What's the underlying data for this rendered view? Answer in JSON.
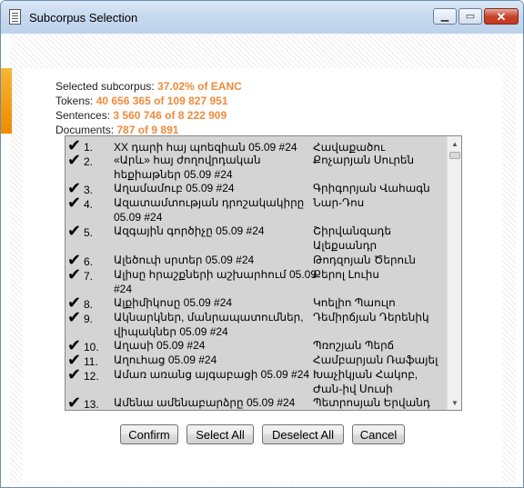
{
  "window": {
    "title": "Subcorpus Selection",
    "minimize": "▁",
    "maximize": "▭",
    "close": "✕"
  },
  "stats": {
    "selected_label": "Selected subcorpus:",
    "selected_value": "37.02% of EANC",
    "tokens_label": "Tokens:",
    "tokens_value": "40 656 365 of 109 827 951",
    "sentences_label": "Sentences:",
    "sentences_value": "3 560 746 of 8 222 909",
    "documents_label": "Documents:",
    "documents_value": "787 of 9 891"
  },
  "list": {
    "check_glyph": "✔",
    "items": [
      {
        "num": "1.",
        "title": "XX դարի հայ պոեզիան 05.09 #24",
        "author": "Հավաքածու",
        "checked": true
      },
      {
        "num": "2.",
        "title": "«Արև» հայ ժողովրդական հեքիաթներ 05.09 #24",
        "author": "Քոչարյան Սուրեն",
        "checked": true
      },
      {
        "num": "3.",
        "title": "Աղամամուբ 05.09 #24",
        "author": "Գրիգորյան Վահագն",
        "checked": true
      },
      {
        "num": "4.",
        "title": "Ազատամտության դրոշակակիրը 05.09 #24",
        "author": "Նար-Դոս",
        "checked": true
      },
      {
        "num": "5.",
        "title": "Ազգային գործիչը 05.09 #24",
        "author": "Շիրվանզադե Ալեքսանդր",
        "checked": true
      },
      {
        "num": "6.",
        "title": "Ալեծուփ սրտեր 05.09 #24",
        "author": "Թոդզոյան Ծերուն",
        "checked": true
      },
      {
        "num": "7.",
        "title": "Ալիսը հրաշքների աշխարհում 05.09 #24",
        "author": "Քերոլ Լուիս",
        "checked": true
      },
      {
        "num": "8.",
        "title": "Ալքիմիկոսը 05.09 #24",
        "author": "Կոելիո Պաուլո",
        "checked": true
      },
      {
        "num": "9.",
        "title": "Ակնարկներ, մանրապատումներ, վիպակներ 05.09 #24",
        "author": "Դեմիրճյան Դերենիկ",
        "checked": true
      },
      {
        "num": "10.",
        "title": "Աղասի 05.09 #24",
        "author": "Պռոշյան Պերճ",
        "checked": true
      },
      {
        "num": "11.",
        "title": "Աղուհաց 05.09 #24",
        "author": "Համբարյան Ռաֆայել",
        "checked": true
      },
      {
        "num": "12.",
        "title": "Ամառ առանց այգաբացի 05.09 #24",
        "author": "Խաչիկյան Հակոբ, Ժան-իվ Սուսի",
        "checked": true
      },
      {
        "num": "13.",
        "title": "Ամենա ամենաբարձրը 05.09 #24",
        "author": "Պետրոսյան Երվանդ",
        "checked": true
      }
    ]
  },
  "scrollbar": {
    "up": "▲",
    "down": "▼"
  },
  "buttons": {
    "confirm": "Confirm",
    "select_all": "Select All",
    "deselect_all": "Deselect All",
    "cancel": "Cancel"
  }
}
